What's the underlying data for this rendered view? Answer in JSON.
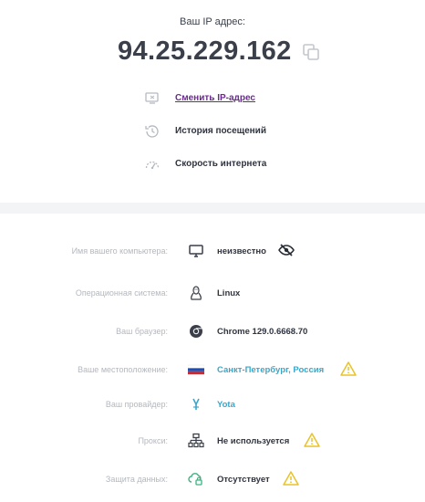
{
  "ip": {
    "label": "Ваш IP адрес:",
    "address": "94.25.229.162"
  },
  "actions": {
    "change_ip": "Сменить IP-адрес",
    "history": "История посещений",
    "speed": "Скорость интернета"
  },
  "info": {
    "computer_name": {
      "label": "Имя вашего компьютера:",
      "value": "неизвестно"
    },
    "os": {
      "label": "Операционная система:",
      "value": "Linux"
    },
    "browser": {
      "label": "Ваш браузер:",
      "value": "Chrome 129.0.6668.70"
    },
    "location": {
      "label": "Ваше местоположение:",
      "value": "Санкт-Петербург, Россия"
    },
    "provider": {
      "label": "Ваш провайдер:",
      "value": "Yota"
    },
    "proxy": {
      "label": "Прокси:",
      "value": "Не используется"
    },
    "data_protection": {
      "label": "Защита данных:",
      "value": "Отсутствует"
    }
  },
  "colors": {
    "link_purple": "#6b2a8f",
    "link_cyan": "#3aa7c9",
    "warning_yellow": "#e8c22a",
    "label_gray": "#b3b8bf"
  }
}
